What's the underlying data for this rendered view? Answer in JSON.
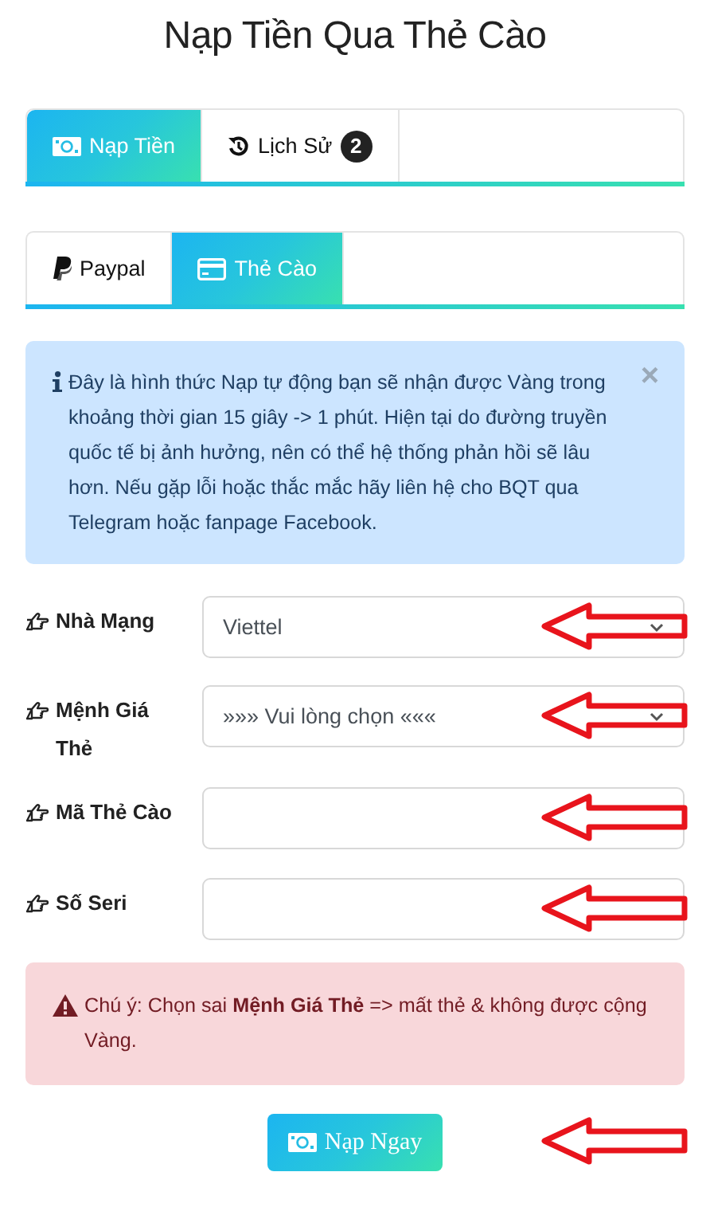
{
  "title": "Nạp Tiền Qua Thẻ Cào",
  "main_tabs": [
    {
      "label": "Nạp Tiền",
      "kind": "money",
      "selected": true
    },
    {
      "label": "Lịch Sử",
      "kind": "history",
      "selected": false,
      "badge": "2"
    }
  ],
  "method_tabs": [
    {
      "label": "Paypal",
      "kind": "paypal",
      "selected": false
    },
    {
      "label": "Thẻ Cào",
      "kind": "card",
      "selected": true
    }
  ],
  "info_alert": {
    "text": "Đây là hình thức Nạp tự động bạn sẽ nhận được Vàng trong khoảng thời gian 15 giây -> 1 phút. Hiện tại do đường truyền quốc tế bị ảnh hưởng, nên có thể hệ thống phản hồi sẽ lâu hơn. Nếu gặp lỗi hoặc thắc mắc hãy liên hệ cho BQT qua Telegram hoặc fanpage Facebook.",
    "close": "×"
  },
  "fields": [
    {
      "label": "Nhà Mạng",
      "kind": "select",
      "value": "Viettel",
      "arrow": true
    },
    {
      "label": "Mệnh Giá Thẻ",
      "kind": "select",
      "value": "»»» Vui lòng chọn «««",
      "arrow": true
    },
    {
      "label": "Mã Thẻ Cào",
      "kind": "text",
      "arrow": true
    },
    {
      "label": "Số Seri",
      "kind": "text",
      "arrow": true
    }
  ],
  "warning": {
    "text": "Chú ý: Chọn sai **Mệnh Giá Thẻ** => mất thẻ & không được cộng Vàng."
  },
  "submit": {
    "label": "Nạp Ngay",
    "arrow": true
  }
}
